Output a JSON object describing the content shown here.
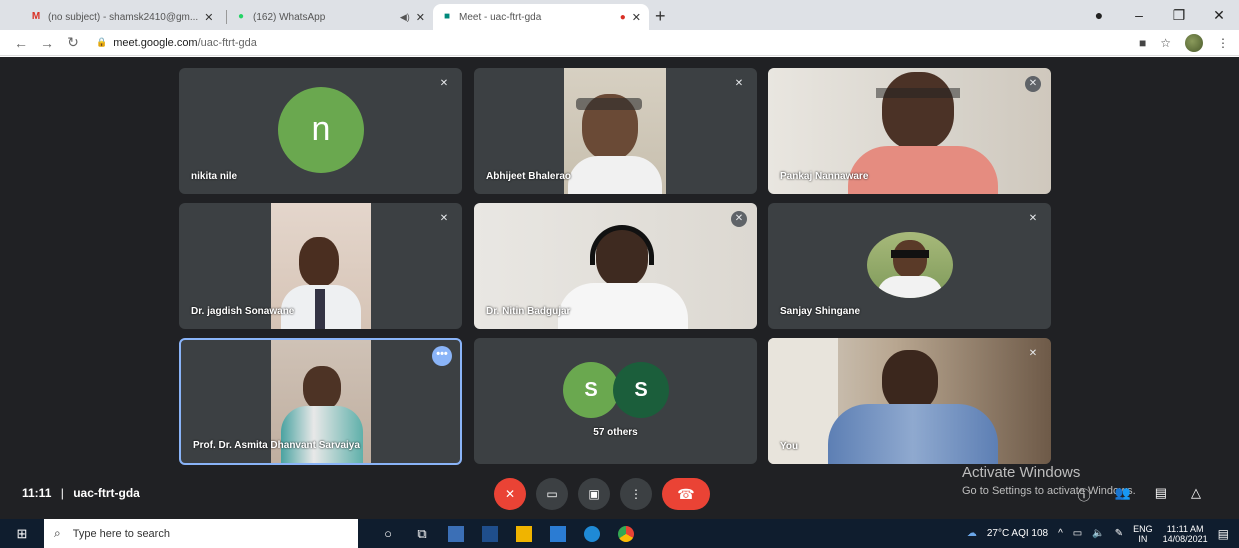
{
  "tabs": [
    {
      "title": "(no subject) - shamsk2410@gm...",
      "icon": "gmail-icon",
      "active": false
    },
    {
      "title": "(162) WhatsApp",
      "icon": "whatsapp-icon",
      "active": false
    },
    {
      "title": "Meet - uac-ftrt-gda",
      "icon": "meet-icon",
      "active": true
    }
  ],
  "address": {
    "host": "meet.google.com",
    "path": "/uac-ftrt-gda"
  },
  "participants": [
    {
      "name": "nikita nile",
      "initial": "n"
    },
    {
      "name": "Abhijeet Bhalerao"
    },
    {
      "name": "Pankaj Nannaware"
    },
    {
      "name": "Dr. jagdish Sonawane"
    },
    {
      "name": "Dr. Nitin Badgujar"
    },
    {
      "name": "Sanjay Shingane"
    },
    {
      "name": "Prof. Dr. Asmita Dhanvant Sarvaiya"
    },
    {
      "name": "57 others",
      "initials": [
        "S",
        "S"
      ]
    },
    {
      "name": "You"
    }
  ],
  "meeting": {
    "time": "11:11",
    "separator": "|",
    "code": "uac-ftrt-gda"
  },
  "watermark": {
    "line1": "Activate Windows",
    "line2": "Go to Settings to activate Windows."
  },
  "taskbar": {
    "search_placeholder": "Type here to search",
    "weather": "27°C  AQI 108",
    "lang1": "ENG",
    "lang2": "IN",
    "time": "11:11 AM",
    "date": "14/08/2021"
  },
  "colors": {
    "meet_bg": "#202124",
    "tile_bg": "#3c4043",
    "end_call": "#ea4335",
    "selected": "#8ab4f8"
  }
}
